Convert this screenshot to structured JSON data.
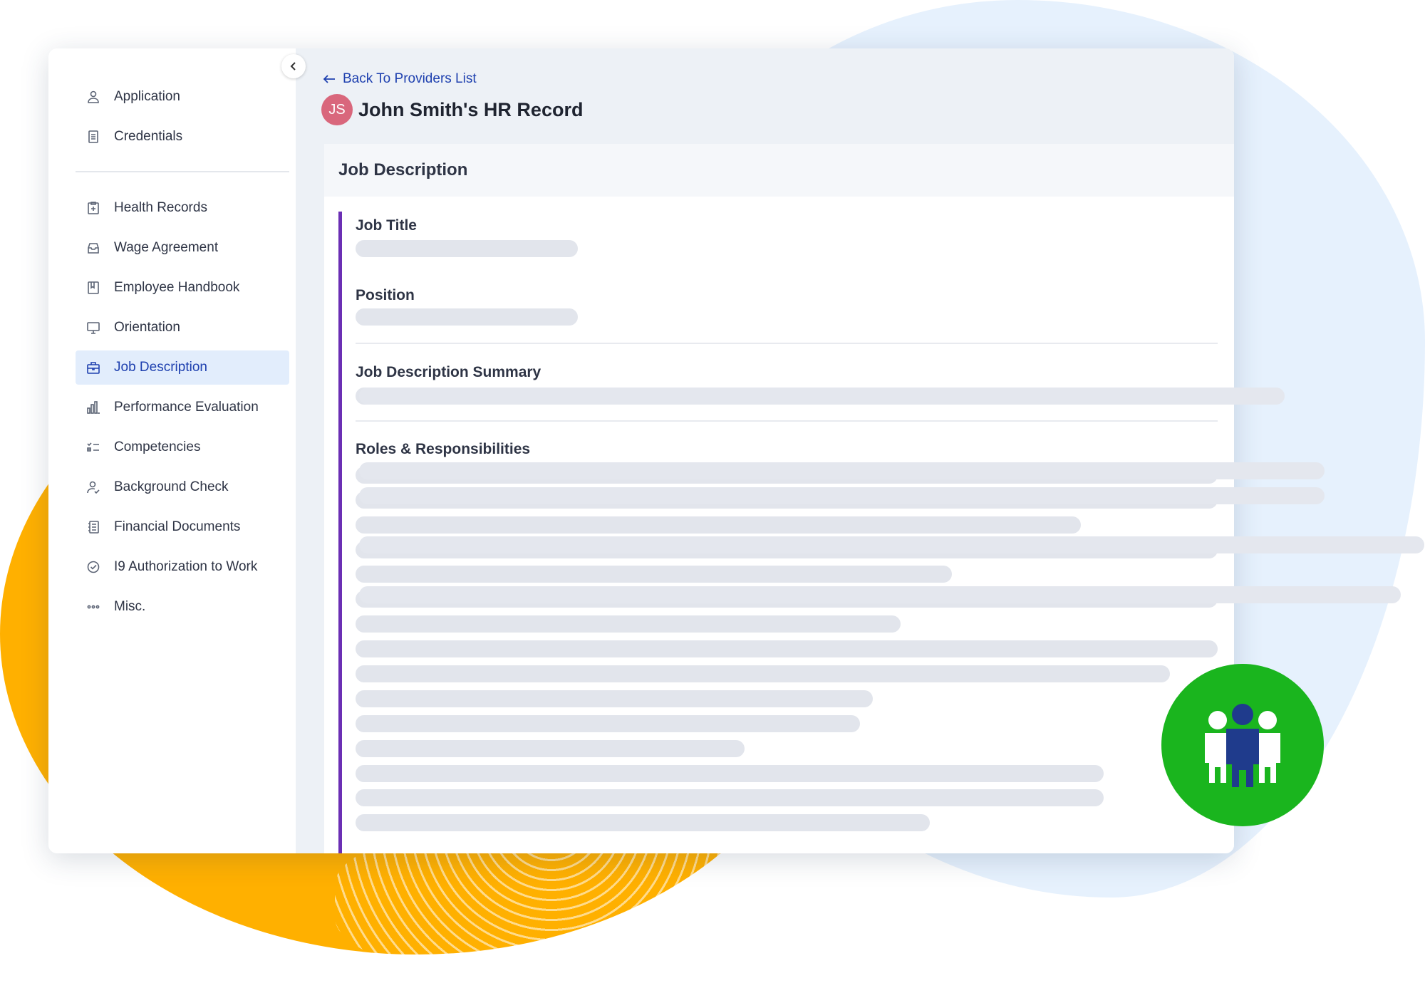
{
  "sidebar": {
    "top_items": [
      {
        "label": "Application",
        "icon": "user-icon"
      },
      {
        "label": "Credentials",
        "icon": "document-icon"
      }
    ],
    "items": [
      {
        "label": "Health Records",
        "icon": "medical-clipboard-icon"
      },
      {
        "label": "Wage Agreement",
        "icon": "inbox-tray-icon"
      },
      {
        "label": "Employee Handbook",
        "icon": "book-icon"
      },
      {
        "label": "Orientation",
        "icon": "presentation-board-icon"
      },
      {
        "label": "Job Description",
        "icon": "briefcase-icon",
        "active": true
      },
      {
        "label": "Performance Evaluation",
        "icon": "bar-chart-icon"
      },
      {
        "label": "Competencies",
        "icon": "checklist-icon"
      },
      {
        "label": "Background Check",
        "icon": "user-check-icon"
      },
      {
        "label": "Financial Documents",
        "icon": "ledger-icon"
      },
      {
        "label": "I9 Authorization to Work",
        "icon": "check-circle-icon"
      },
      {
        "label": "Misc.",
        "icon": "dots-icon"
      }
    ]
  },
  "header": {
    "back_label": "Back To Providers List",
    "avatar_initials": "JS",
    "title": "John Smith's HR Record"
  },
  "card": {
    "title": "Job Description",
    "fields": {
      "job_title": "Job Title",
      "position": "Position",
      "summary": "Job Description Summary",
      "roles": "Roles & Responsibilities"
    }
  },
  "colors": {
    "accent": "#1e40af",
    "active_bg": "#e2edfc",
    "accent_bar": "#6b2fb4",
    "avatar": "#d9677c",
    "badge": "#1ab51e",
    "orange": "#ffb000",
    "blue_blob": "#e6f1fd"
  }
}
